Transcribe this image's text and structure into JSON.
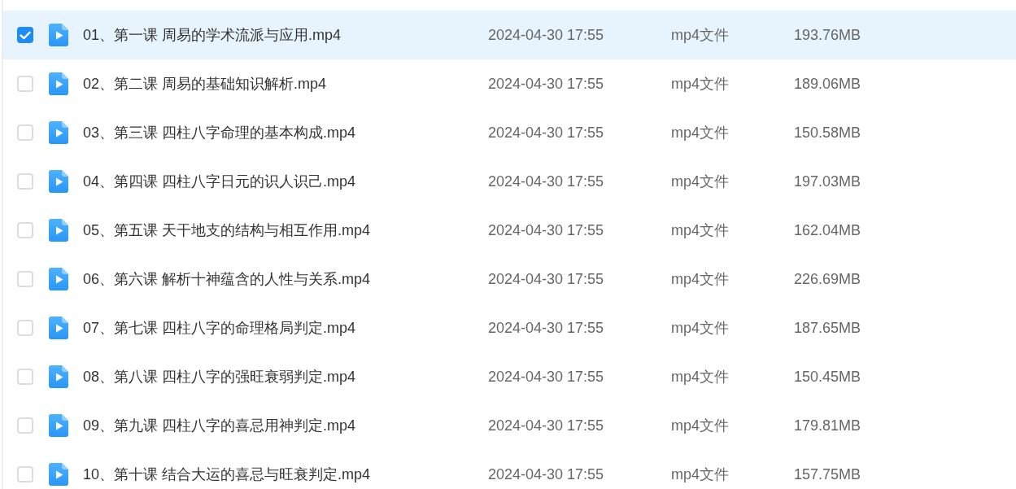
{
  "files": [
    {
      "selected": true,
      "name": "01、第一课 周易的学术流派与应用.mp4",
      "modified": "2024-04-30 17:55",
      "type": "mp4文件",
      "size": "193.76MB"
    },
    {
      "selected": false,
      "name": "02、第二课 周易的基础知识解析.mp4",
      "modified": "2024-04-30 17:55",
      "type": "mp4文件",
      "size": "189.06MB"
    },
    {
      "selected": false,
      "name": "03、第三课 四柱八字命理的基本构成.mp4",
      "modified": "2024-04-30 17:55",
      "type": "mp4文件",
      "size": "150.58MB"
    },
    {
      "selected": false,
      "name": "04、第四课 四柱八字日元的识人识己.mp4",
      "modified": "2024-04-30 17:55",
      "type": "mp4文件",
      "size": "197.03MB"
    },
    {
      "selected": false,
      "name": "05、第五课 天干地支的结构与相互作用.mp4",
      "modified": "2024-04-30 17:55",
      "type": "mp4文件",
      "size": "162.04MB"
    },
    {
      "selected": false,
      "name": "06、第六课 解析十神蕴含的人性与关系.mp4",
      "modified": "2024-04-30 17:55",
      "type": "mp4文件",
      "size": "226.69MB"
    },
    {
      "selected": false,
      "name": "07、第七课 四柱八字的命理格局判定.mp4",
      "modified": "2024-04-30 17:55",
      "type": "mp4文件",
      "size": "187.65MB"
    },
    {
      "selected": false,
      "name": "08、第八课 四柱八字的强旺衰弱判定.mp4",
      "modified": "2024-04-30 17:55",
      "type": "mp4文件",
      "size": "150.45MB"
    },
    {
      "selected": false,
      "name": "09、第九课 四柱八字的喜忌用神判定.mp4",
      "modified": "2024-04-30 17:55",
      "type": "mp4文件",
      "size": "179.81MB"
    },
    {
      "selected": false,
      "name": "10、第十课 结合大运的喜忌与旺衰判定.mp4",
      "modified": "2024-04-30 17:55",
      "type": "mp4文件",
      "size": "157.75MB"
    }
  ]
}
